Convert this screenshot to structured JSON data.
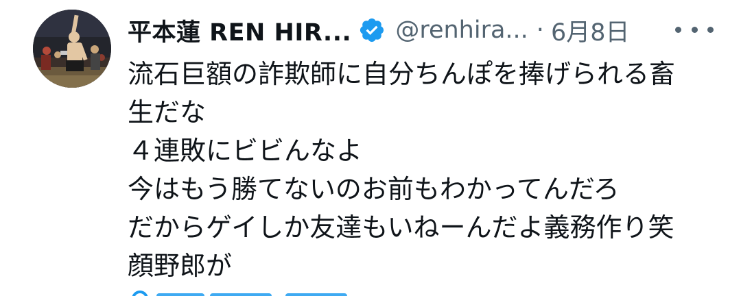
{
  "tweet": {
    "display_name": "平本蓮 REN HIR...",
    "handle": "@renhira...",
    "separator": "·",
    "date": "6月8日",
    "verified_icon": "verified-badge-icon",
    "more_icon": "more-options-icon",
    "body_lines": [
      "流石巨額の詐欺師に自分ちんぽを捧げられる畜",
      "生だな",
      "４連敗にビビんなよ",
      "今はもう勝てないのお前もわかってんだろ",
      "だからゲイしか友達もいねーんだよ義務作り笑",
      "顔野郎が"
    ]
  },
  "colors": {
    "text_primary": "#0f1419",
    "text_secondary": "#536471",
    "accent": "#1d9bf0"
  }
}
